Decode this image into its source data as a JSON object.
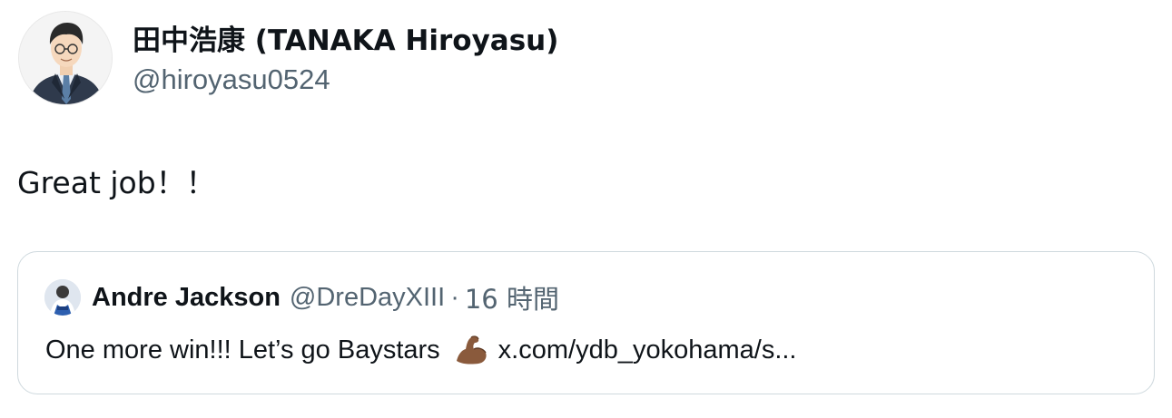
{
  "tweet": {
    "author": {
      "display_name": "田中浩康 (TANAKA Hiroyasu)",
      "handle": "@hiroyasu0524"
    },
    "text": "Great job！！",
    "quoted": {
      "display_name": "Andre Jackson",
      "handle": "@DreDayXIII",
      "separator": "·",
      "time": "16 時間",
      "text_before": "One more win!!! Let’s go Baystars",
      "icon": "flexed-biceps-icon",
      "link": "x.com/ydb_yokohama/s..."
    }
  },
  "colors": {
    "text_primary": "#0f1419",
    "text_secondary": "#536471",
    "border": "#cfd9de"
  }
}
